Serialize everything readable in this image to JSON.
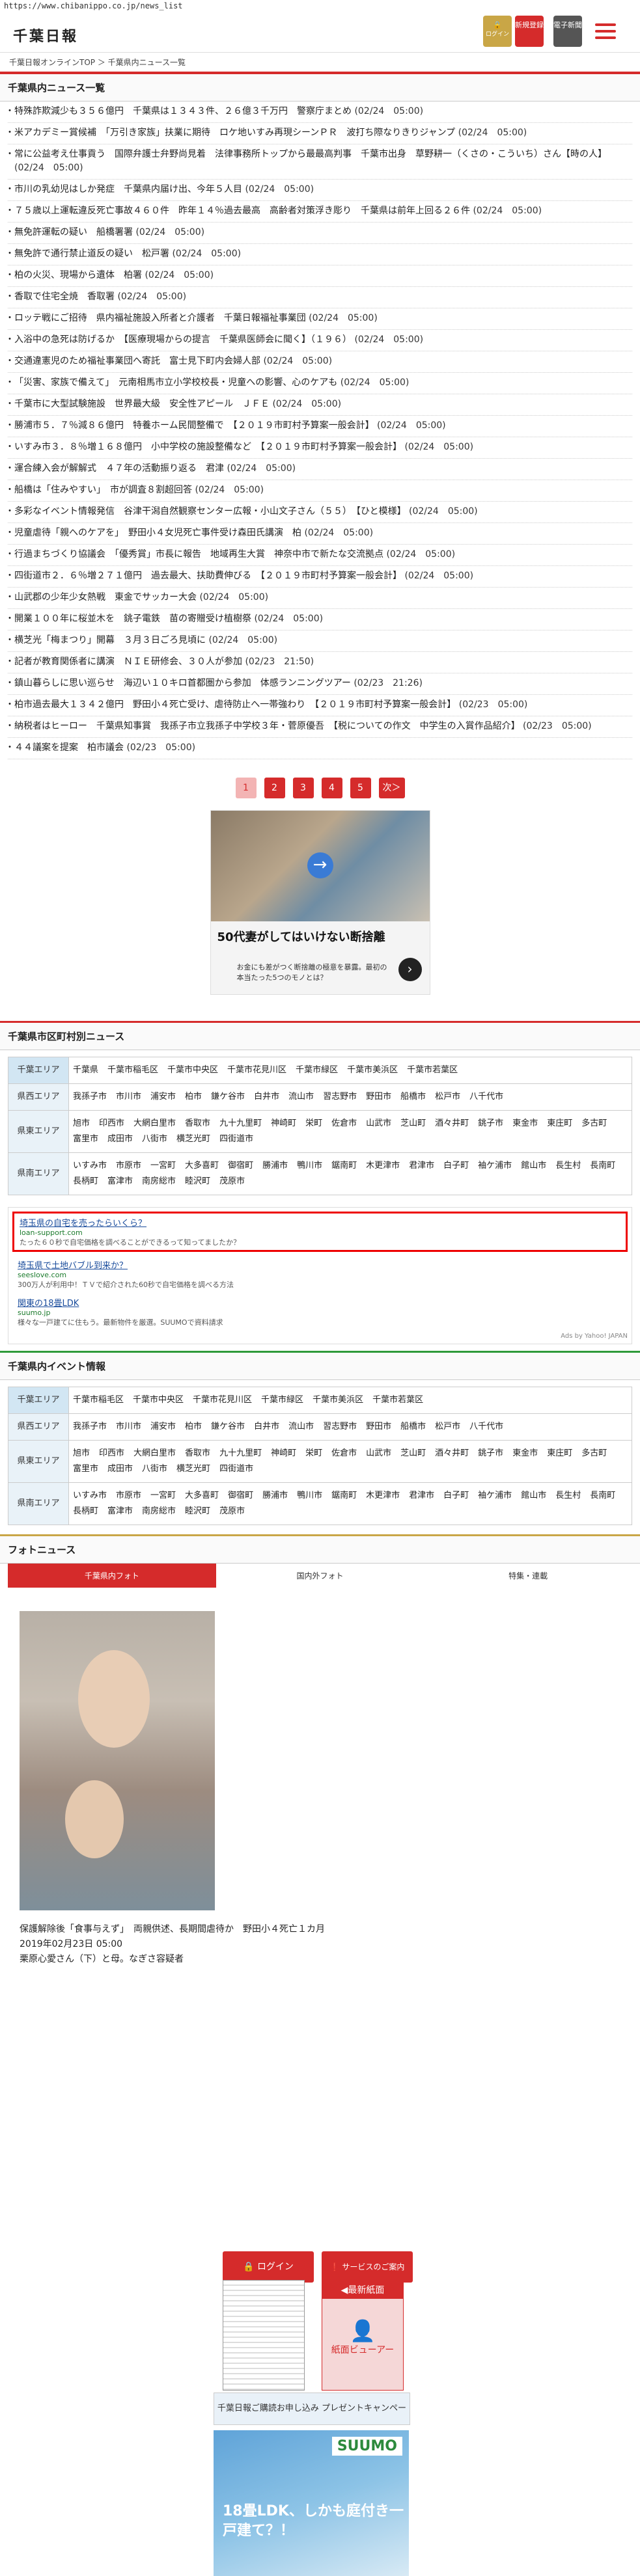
{
  "url": "https://www.chibanippo.co.jp/news_list",
  "header": {
    "logo": "千葉日報",
    "login_label": "ログイン",
    "signup_label": "新規登録",
    "paper_label": "電子新聞"
  },
  "breadcrumb": "千葉日報オンラインTOP ＞ 千葉県内ニュース一覧",
  "news_section_title": "千葉県内ニュース一覧",
  "news": [
    {
      "title": "特殊詐欺減少も３５６億円　千葉県は１３４３件、２６億３千万円　警察庁まとめ",
      "date": "(02/24　05:00)"
    },
    {
      "title": "米アカデミー賞候補　「万引き家族」扶業に期待　ロケ地いすみ再現シーンＰＲ　波打ち際なりきりジャンプ",
      "date": "(02/24　05:00)"
    },
    {
      "title": "常に公益考え仕事貢う　国際弁護士弁野尚見着　法律事務所トップから最最高判事　千葉市出身　草野耕一（くさの・こういち）さん【時の人】",
      "date": "(02/24　05:00)"
    },
    {
      "title": "市川の乳幼児はしか発症　千葉県内届け出、今年５人目",
      "date": "(02/24　05:00)"
    },
    {
      "title": "７５歳以上運転違反死亡事故４６０件　昨年１４％過去最高　高齢者対策浮き彫り　千葉県は前年上回る２６件",
      "date": "(02/24　05:00)"
    },
    {
      "title": "無免許運転の疑い　船橋署署",
      "date": "(02/24　05:00)"
    },
    {
      "title": "無免許で通行禁止道反の疑い　松戸署",
      "date": "(02/24　05:00)"
    },
    {
      "title": "柏の火災、現場から遺体　柏署",
      "date": "(02/24　05:00)"
    },
    {
      "title": "香取で住宅全焼　香取署",
      "date": "(02/24　05:00)"
    },
    {
      "title": "ロッテ戦にご招待　県内福祉施設入所者と介護者　千葉日報福祉事業団",
      "date": "(02/24　05:00)"
    },
    {
      "title": "入浴中の急死は防げるか　【医療現場からの提言　千葉県医師会に聞く】（１９６）",
      "date": "(02/24　05:00)"
    },
    {
      "title": "交通違憲児のため福祉事業団へ寄託　富士見下町内会婦人部",
      "date": "(02/24　05:00)"
    },
    {
      "title": "「災害、家族で備えて」　元南相馬市立小学校校長・児童への影響、心のケアも",
      "date": "(02/24　05:00)"
    },
    {
      "title": "千葉市に大型試験施設　世界最大級　安全性アピール　ＪＦＥ",
      "date": "(02/24　05:00)"
    },
    {
      "title": "勝浦市５．７％減８６億円　特養ホーム民間整備で　【２０１９市町村予算案一般会計】",
      "date": "(02/24　05:00)"
    },
    {
      "title": "いすみ市３．８％増１６８億円　小中学校の施設整備など　【２０１９市町村予算案一般会計】",
      "date": "(02/24　05:00)"
    },
    {
      "title": "運合練入会が解解式　４７年の活動振り返る　君津",
      "date": "(02/24　05:00)"
    },
    {
      "title": "船橋は「住みやすい」　市が調査８割超回答",
      "date": "(02/24　05:00)"
    },
    {
      "title": "多彩なイベント情報発信　谷津干潟自然観察センター広報・小山文子さん（５５）　【ひと模様】",
      "date": "(02/24　05:00)"
    },
    {
      "title": "児童虐待「親へのケアを」　野田小４女児死亡事件受け森田氏講演　柏",
      "date": "(02/24　05:00)"
    },
    {
      "title": "行過まちづくり協議会　「優秀賞」市長に報告　地域再生大賞　神奈中市で新たな交流拠点",
      "date": "(02/24　05:00)"
    },
    {
      "title": "四街道市２．６％増２７１億円　過去最大、扶助費伸びる　【２０１９市町村予算案一般会計】",
      "date": "(02/24　05:00)"
    },
    {
      "title": "山武郡の少年少女熱戦　東金でサッカー大会",
      "date": "(02/24　05:00)"
    },
    {
      "title": "開業１００年に桜並木を　銚子電鉄　苗の寄贈受け植樹祭",
      "date": "(02/24　05:00)"
    },
    {
      "title": "横芝光「梅まつり」開幕　３月３日ごろ見頃に",
      "date": "(02/24　05:00)"
    },
    {
      "title": "記者が教育関係者に講演　ＮＩＥ研修会、３０人が参加",
      "date": "(02/23　21:50)"
    },
    {
      "title": "鎮山暮らしに思い巡らせ　海辺い１０キロ首都圏から参加　体感ランニングツアー",
      "date": "(02/23　21:26)"
    },
    {
      "title": "柏市過去最大１３４２億円　野田小４死亡受け、虐待防止へ一帯強わり　【２０１９市町村予算案一般会計】",
      "date": "(02/23　05:00)"
    },
    {
      "title": "納税者はヒーロー　千葉県知事賞　我孫子市立我孫子中学校３年・菅原優吾　【税についての作文　中学生の入賞作品紹介】",
      "date": "(02/23　05:00)"
    },
    {
      "title": "４４議案を提案　柏市議会",
      "date": "(02/23　05:00)"
    }
  ],
  "pager": [
    "1",
    "2",
    "3",
    "4",
    "5",
    "次＞"
  ],
  "ad1": {
    "headline": "50代妻がしてはいけない断捨離",
    "sub": "お金にも差がつく断捨離の極意を暴露。最初の本当たった5つのモノとは？",
    "next": "›",
    "arrow": "→"
  },
  "municipal_section_title": "千葉県市区町村別ニュース",
  "municipal_areas": [
    {
      "label": "千葉エリア",
      "cities": [
        "千葉県",
        "千葉市稲毛区",
        "千葉市中央区",
        "千葉市花見川区",
        "千葉市緑区",
        "千葉市美浜区",
        "千葉市若葉区"
      ]
    },
    {
      "label": "県西エリア",
      "cities": [
        "我孫子市",
        "市川市",
        "浦安市",
        "柏市",
        "鎌ケ谷市",
        "白井市",
        "流山市",
        "習志野市",
        "野田市",
        "船橋市",
        "松戸市",
        "八千代市"
      ]
    },
    {
      "label": "県東エリア",
      "cities": [
        "旭市",
        "印西市",
        "大網白里市",
        "香取市",
        "九十九里町",
        "神崎町",
        "栄町",
        "佐倉市",
        "山武市",
        "芝山町",
        "酒々井町",
        "銚子市",
        "東金市",
        "東庄町",
        "多古町",
        "富里市",
        "成田市",
        "八街市",
        "横芝光町",
        "四街道市"
      ]
    },
    {
      "label": "県南エリア",
      "cities": [
        "いすみ市",
        "市原市",
        "一宮町",
        "大多喜町",
        "御宿町",
        "勝浦市",
        "鴨川市",
        "鋸南町",
        "木更津市",
        "君津市",
        "白子町",
        "袖ケ浦市",
        "館山市",
        "長生村",
        "長南町",
        "長柄町",
        "富津市",
        "南房総市",
        "睦沢町",
        "茂原市"
      ]
    }
  ],
  "yahoo_ads": [
    {
      "title": "埼玉県の自宅を売ったらいくら？",
      "url": "loan-support.com",
      "desc": "たった６０秒で自宅価格を調べることができるって知ってましたか？"
    },
    {
      "title": "埼玉県で土地バブル到来か？",
      "url": "seeslove.com",
      "desc": "300万人が利用中！ＴＶで紹介された60秒で自宅価格を調べる方法"
    },
    {
      "title": "関東の18畳LDK",
      "url": "suumo.jp",
      "desc": "様々な一戸建てに住もう。最新物件を厳選。SUUMOで資料請求"
    }
  ],
  "yahoo_footer": "Ads by Yahoo! JAPAN",
  "events_section_title": "千葉県内イベント情報",
  "event_areas": [
    {
      "label": "千葉エリア",
      "cities": [
        "千葉市稲毛区",
        "千葉市中央区",
        "千葉市花見川区",
        "千葉市緑区",
        "千葉市美浜区",
        "千葉市若葉区"
      ]
    },
    {
      "label": "県西エリア",
      "cities": [
        "我孫子市",
        "市川市",
        "浦安市",
        "柏市",
        "鎌ケ谷市",
        "白井市",
        "流山市",
        "習志野市",
        "野田市",
        "船橋市",
        "松戸市",
        "八千代市"
      ]
    },
    {
      "label": "県東エリア",
      "cities": [
        "旭市",
        "印西市",
        "大網白里市",
        "香取市",
        "九十九里町",
        "神崎町",
        "栄町",
        "佐倉市",
        "山武市",
        "芝山町",
        "酒々井町",
        "銚子市",
        "東金市",
        "東庄町",
        "多古町",
        "富里市",
        "成田市",
        "八街市",
        "横芝光町",
        "四街道市"
      ]
    },
    {
      "label": "県南エリア",
      "cities": [
        "いすみ市",
        "市原市",
        "一宮町",
        "大多喜町",
        "御宿町",
        "勝浦市",
        "鴨川市",
        "鋸南町",
        "木更津市",
        "君津市",
        "白子町",
        "袖ケ浦市",
        "館山市",
        "長生村",
        "長南町",
        "長柄町",
        "富津市",
        "南房総市",
        "睦沢町",
        "茂原市"
      ]
    }
  ],
  "photo_section_title": "フォトニュース",
  "photo_tabs": [
    "千葉県内フォト",
    "国内外フォト",
    "特集・連載"
  ],
  "photo_caption": {
    "title": "保護解除後「食事与えず」　両親供述、長期間虐待か　野田小４死亡１カ月",
    "date": "2019年02月23日 05:00",
    "desc": "栗原心愛さん（下）と母。なぎさ容疑者"
  },
  "sidebar": {
    "login_label": "ログイン",
    "service_label": "サービスのご案内",
    "latest_paper": "◀最新紙面",
    "viewer_label": "紙面ビューアー",
    "banner_text": "千葉日報ご購読お申し込み プレゼントキャンペーン実施中！",
    "suumo_logo": "SUUMO",
    "suumo_text": "18畳LDK、しかも庭付き一戸建て？！"
  }
}
